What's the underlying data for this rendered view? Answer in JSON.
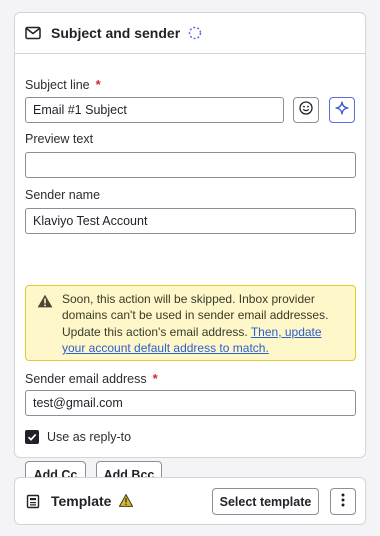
{
  "subject_card": {
    "title": "Subject and sender",
    "subject_line": {
      "label": "Subject line",
      "required_mark": "*",
      "value": "Email #1 Subject",
      "emoji_icon": "emoji-smile-icon",
      "ai_icon": "sparkle-icon"
    },
    "preview_text": {
      "label": "Preview text",
      "value": ""
    },
    "sender_name": {
      "label": "Sender name",
      "value": "Klaviyo Test Account"
    },
    "warning": {
      "text": "Soon, this action will be skipped. Inbox provider domains can't be used in sender email addresses. Update this action's email address. ",
      "link_text": "Then, update your account default address to match.",
      "color": "#fdf7c9"
    },
    "sender_email": {
      "label": "Sender email address",
      "required_mark": "*",
      "value": "test@gmail.com"
    },
    "reply_to": {
      "label": "Use as reply-to",
      "checked": true
    },
    "add_cc_label": "Add Cc",
    "add_bcc_label": "Add Bcc"
  },
  "template_card": {
    "title": "Template",
    "select_label": "Select template",
    "menu_icon": "more-vertical-icon"
  },
  "colors": {
    "required": "#d6263b",
    "link": "#2c5fcf",
    "ai_accent": "#5b6ee0",
    "warning_border": "#e3c93a"
  }
}
